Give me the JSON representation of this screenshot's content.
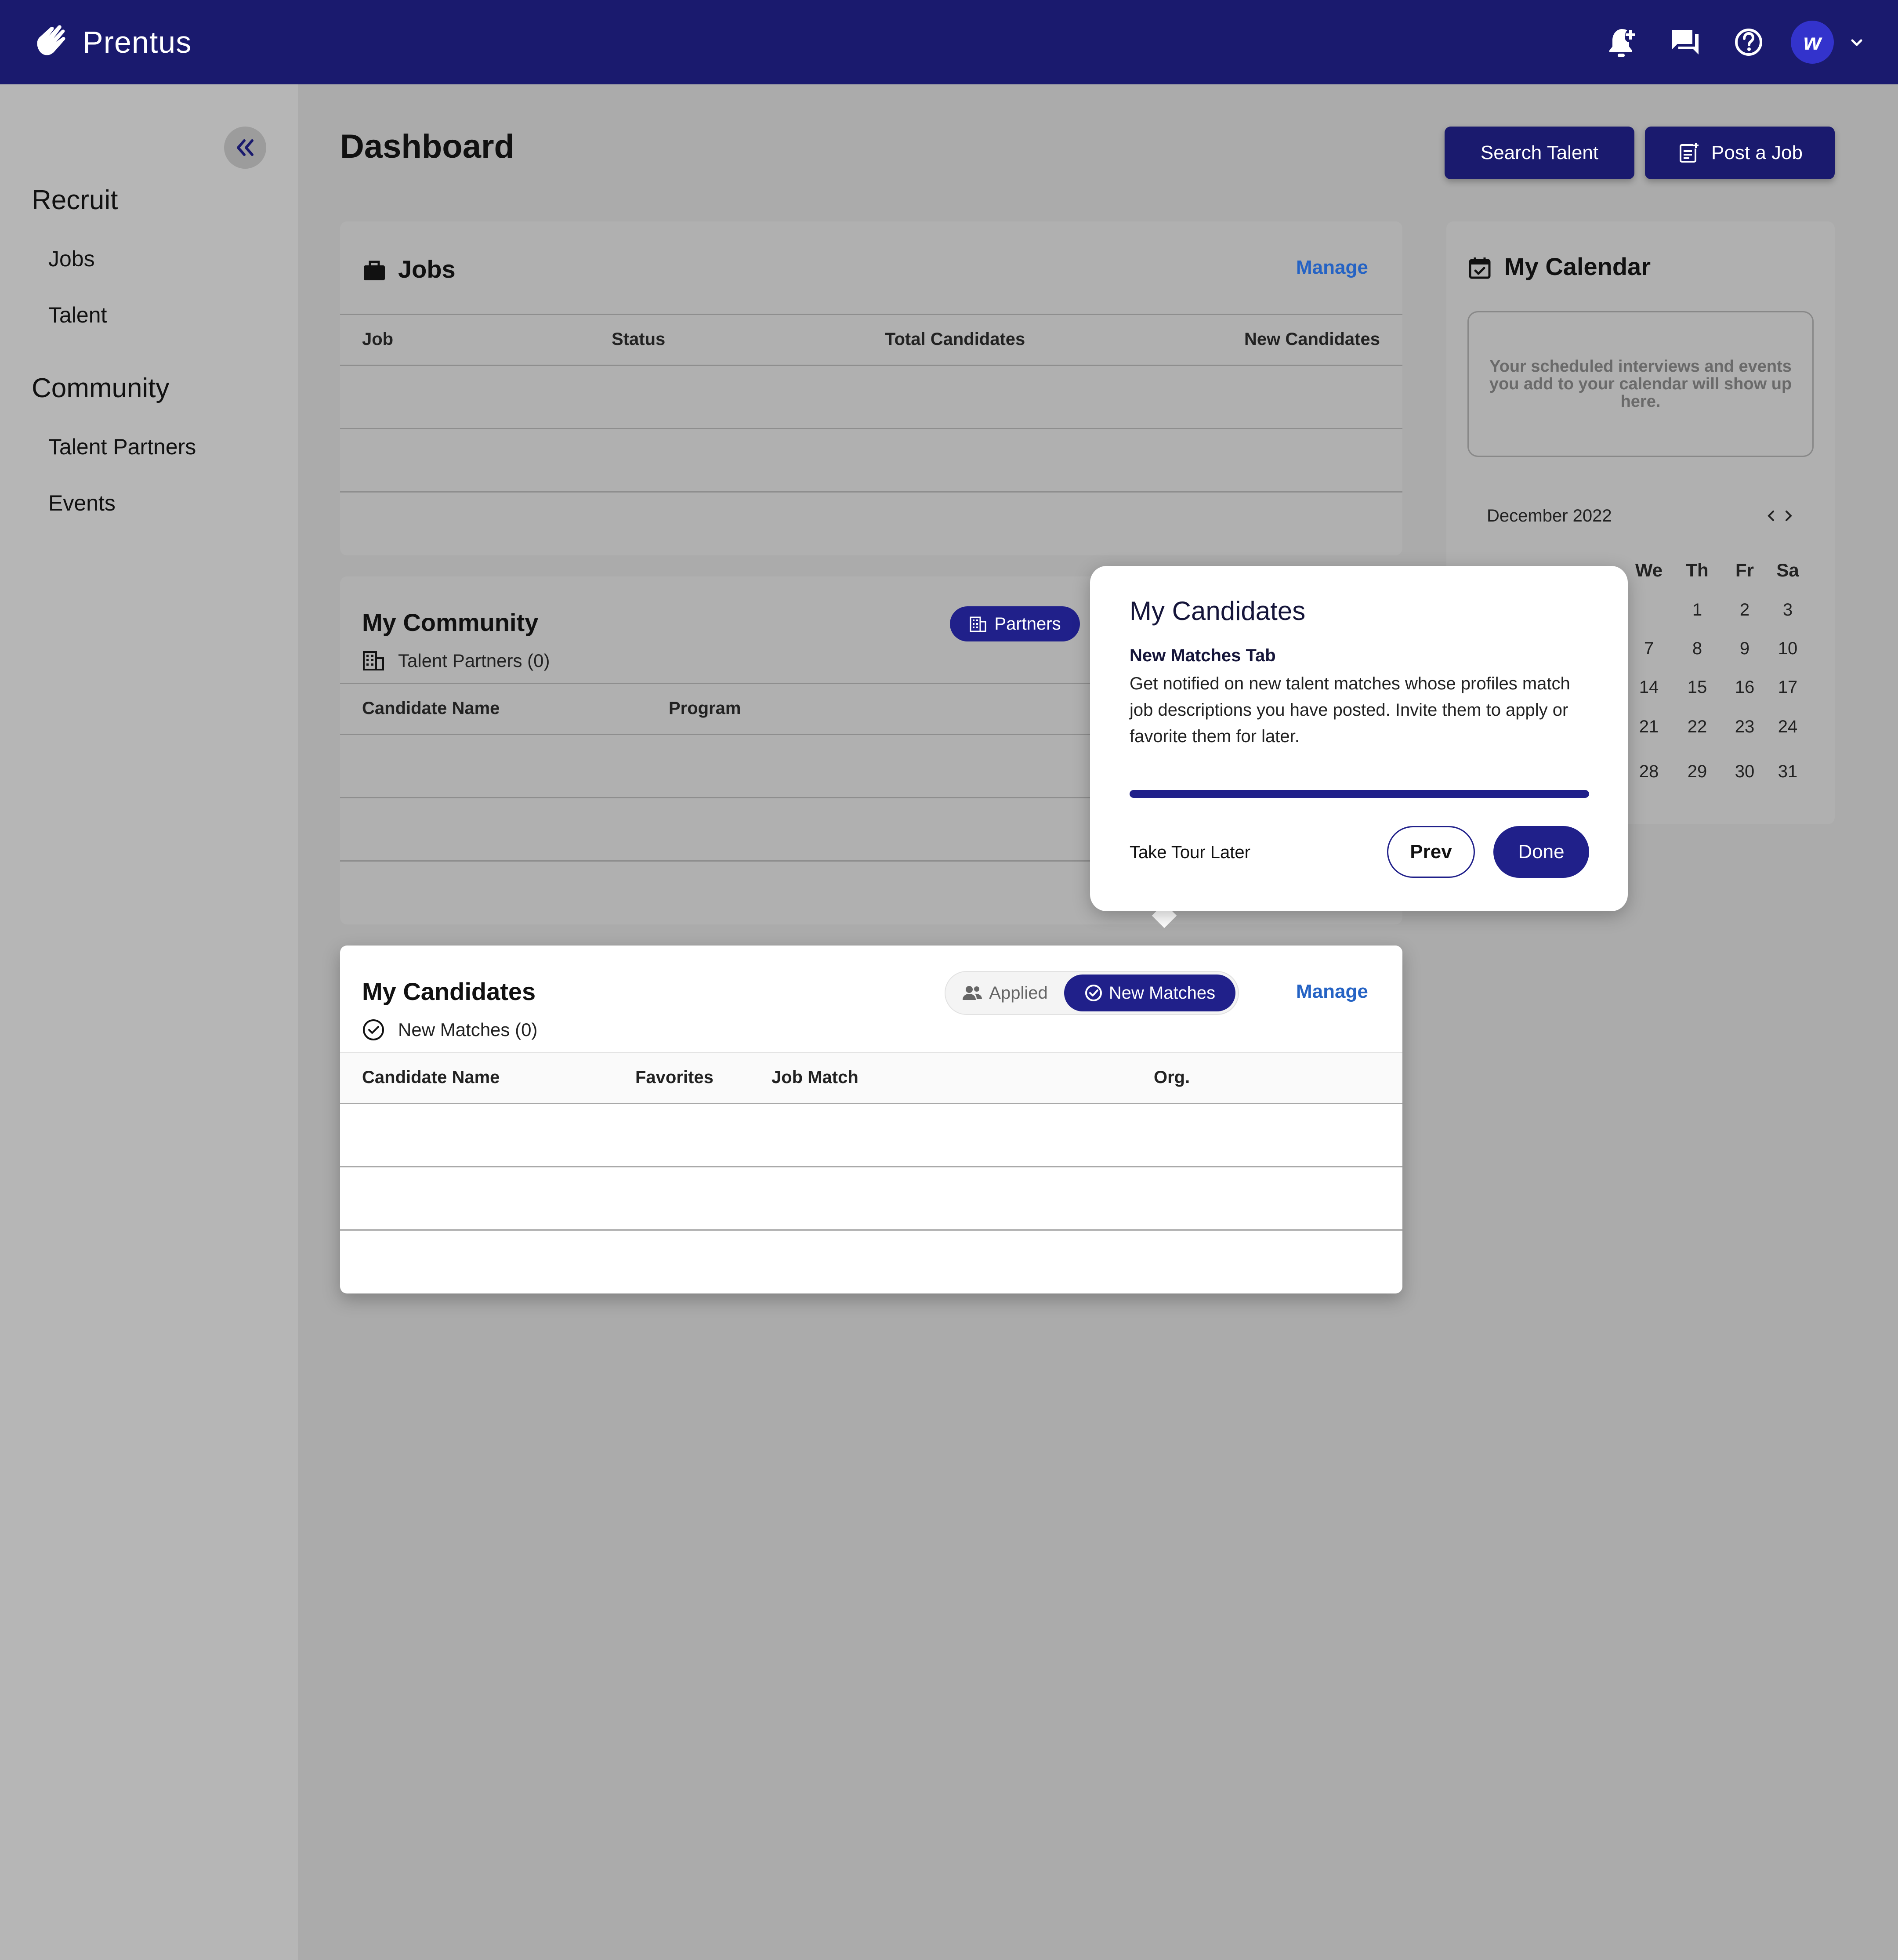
{
  "app": {
    "name": "Prentus",
    "avatar_initial": "w"
  },
  "sidebar": {
    "sections": [
      {
        "title": "Recruit",
        "items": [
          "Jobs",
          "Talent"
        ]
      },
      {
        "title": "Community",
        "items": [
          "Talent Partners",
          "Events"
        ]
      }
    ]
  },
  "header": {
    "title": "Dashboard",
    "search_talent": "Search Talent",
    "post_job": "Post a Job"
  },
  "jobs": {
    "title": "Jobs",
    "manage": "Manage",
    "columns": [
      "Job",
      "Status",
      "Total Candidates",
      "New Candidates"
    ]
  },
  "community": {
    "title": "My Community",
    "partners_tab": "Partners",
    "subtitle": "Talent Partners (0)",
    "columns": [
      "Candidate Name",
      "Program"
    ]
  },
  "candidates": {
    "title": "My Candidates",
    "tab_applied": "Applied",
    "tab_new_matches": "New Matches",
    "manage": "Manage",
    "subtitle": "New Matches (0)",
    "columns": [
      "Candidate Name",
      "Favorites",
      "Job Match",
      "Org."
    ]
  },
  "calendar": {
    "title": "My Calendar",
    "empty_message": "Your scheduled interviews and events you add to your calendar will show up here.",
    "month": "December 2022",
    "weekdays_visible": [
      "We",
      "Th",
      "Fr",
      "Sa"
    ],
    "weeks": [
      [
        "",
        "1",
        "2",
        "3"
      ],
      [
        "7",
        "8",
        "9",
        "10"
      ],
      [
        "14",
        "15",
        "16",
        "17"
      ],
      [
        "21",
        "22",
        "23",
        "24"
      ],
      [
        "28",
        "29",
        "30",
        "31"
      ]
    ]
  },
  "tour": {
    "title": "My Candidates",
    "subtitle": "New Matches Tab",
    "body": "Get notified on new talent matches whose profiles match job descriptions you have posted. Invite them to apply or favorite them for later.",
    "progress": 1.0,
    "later": "Take Tour Later",
    "prev": "Prev",
    "done": "Done"
  },
  "colors": {
    "brand": "#1a1a6e",
    "link": "#2563c4",
    "accent_pill": "#20208a"
  }
}
